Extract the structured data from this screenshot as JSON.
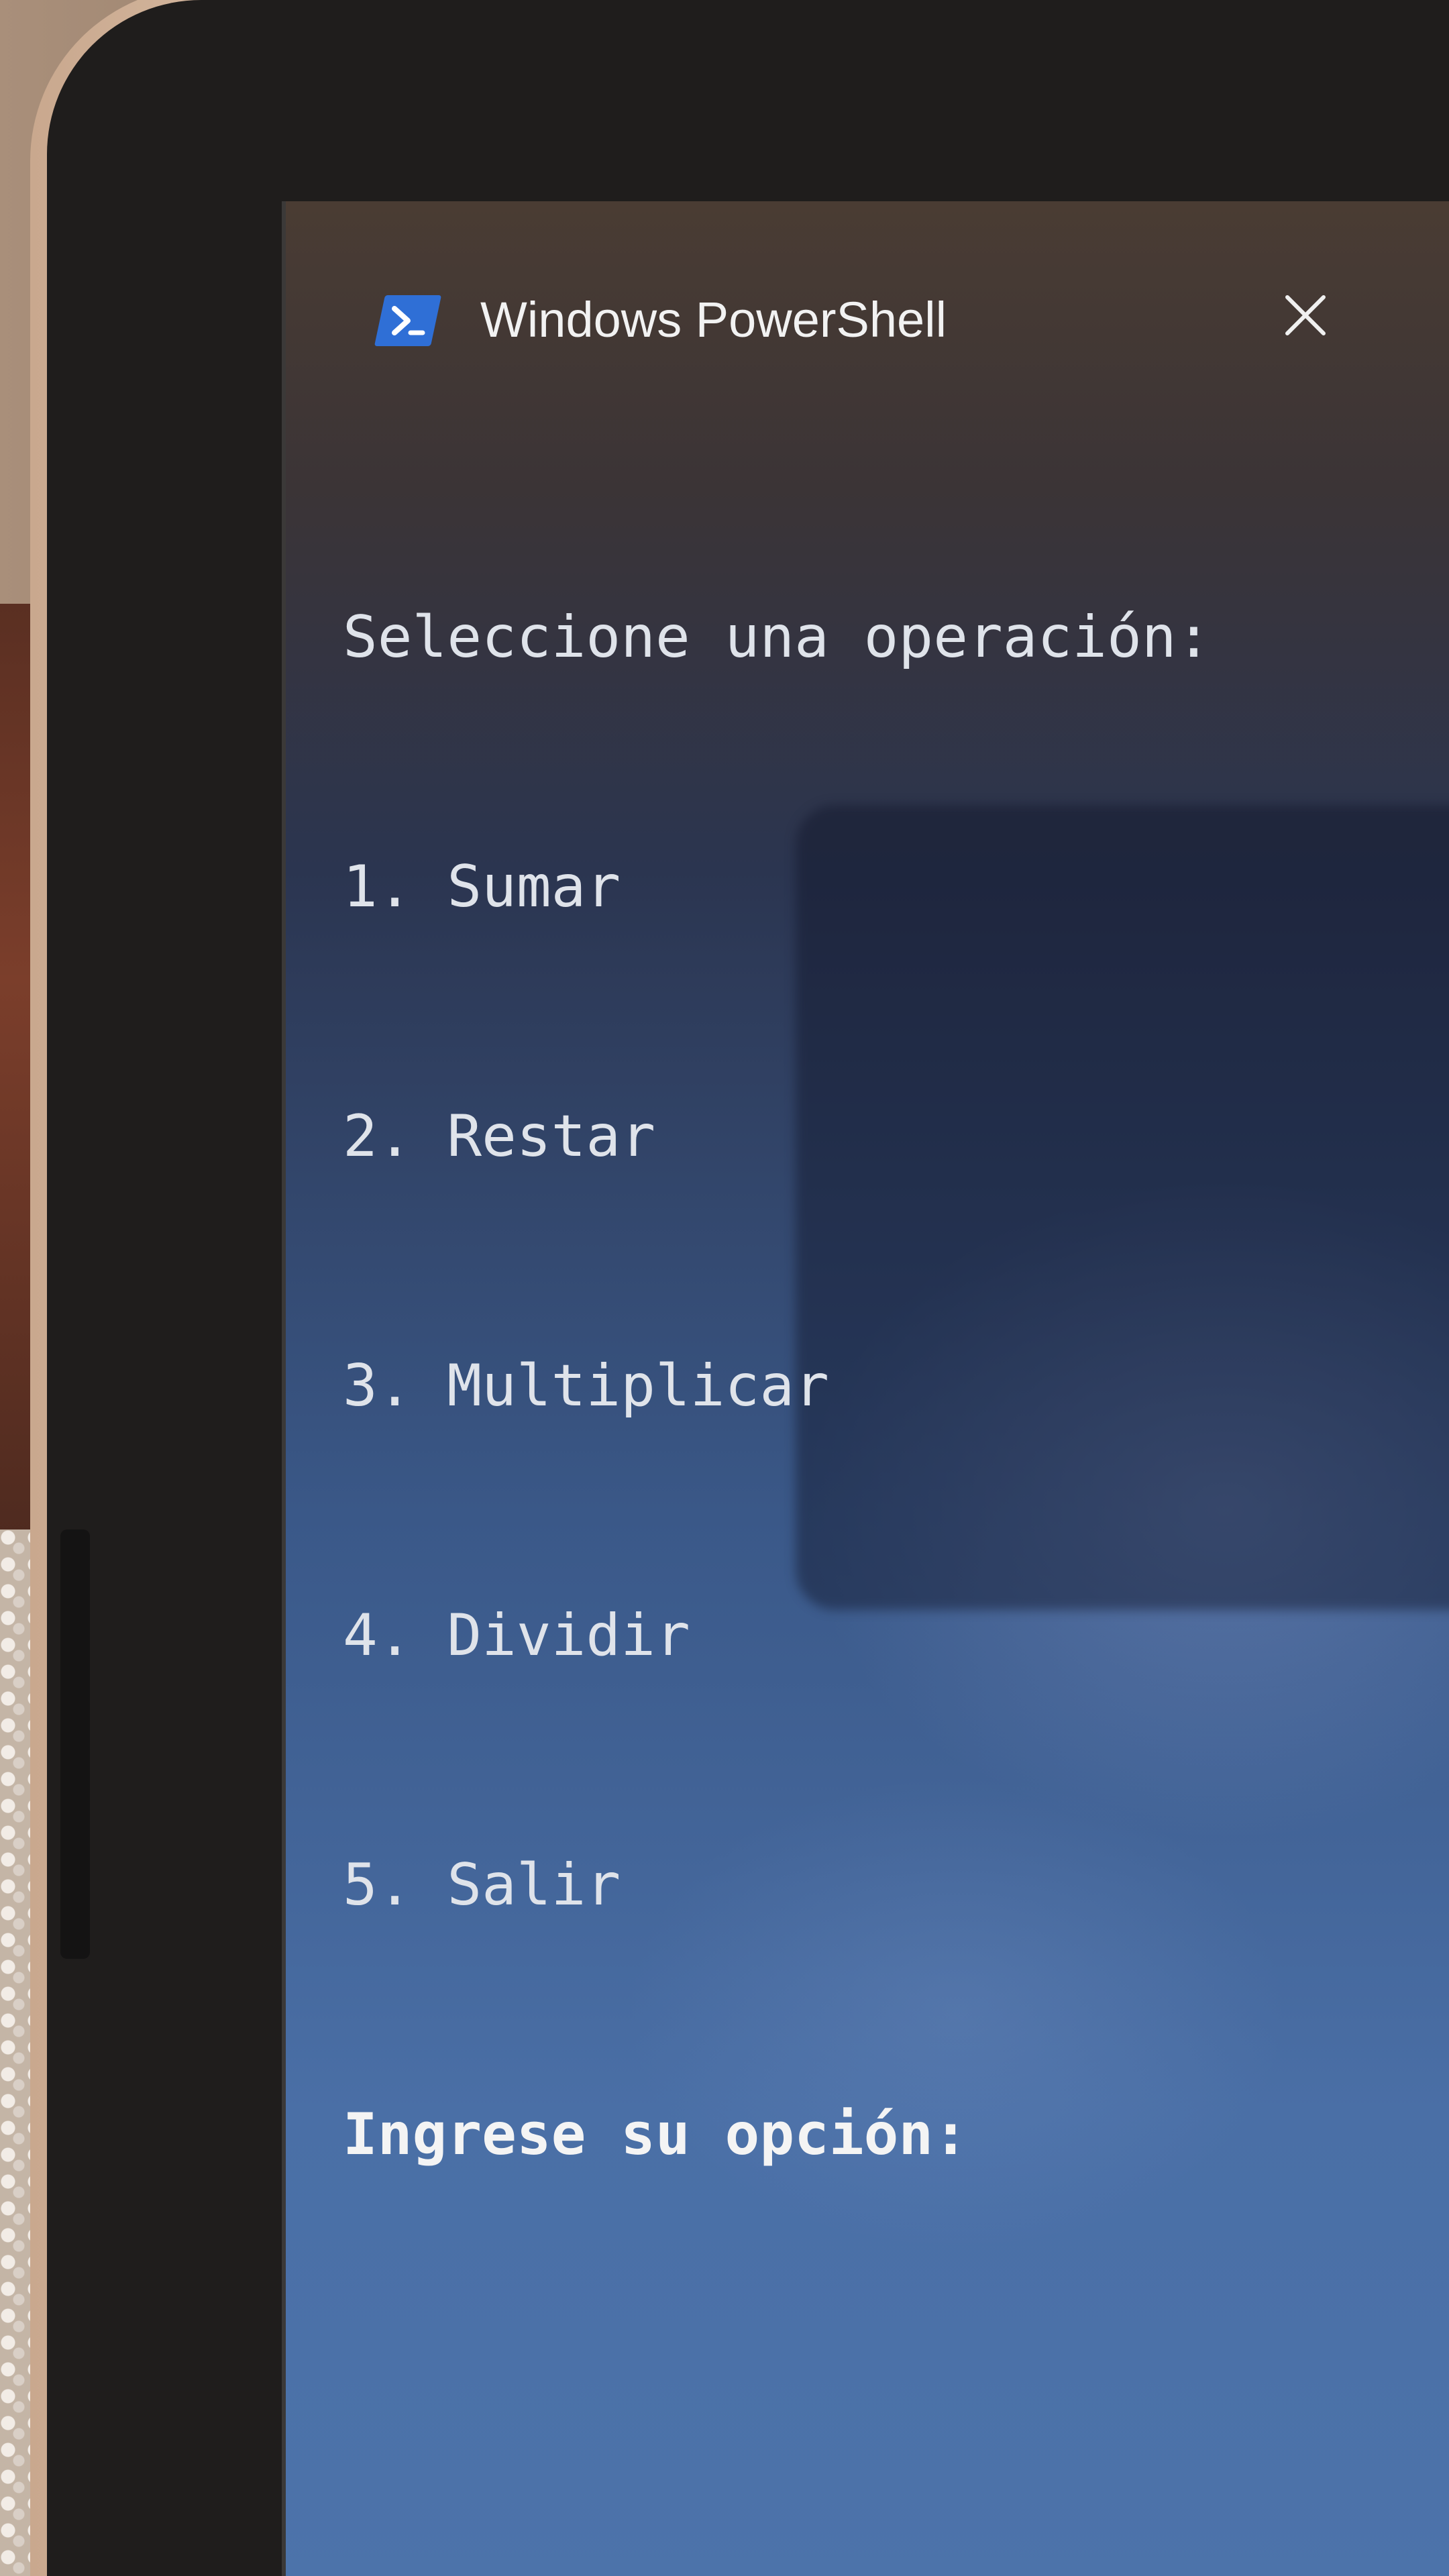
{
  "window": {
    "title": "Windows PowerShell",
    "icon": "powershell-icon",
    "close_icon": "close-icon"
  },
  "console": {
    "prompt": "Seleccione una operación:",
    "options": [
      "1. Sumar",
      "2. Restar",
      "3. Multiplicar",
      "4. Dividir",
      "5. Salir"
    ],
    "input_prompt": "Ingrese su opción:"
  },
  "colors": {
    "console_text": "#dfe3ea",
    "icon_blue": "#2f6fd6"
  }
}
